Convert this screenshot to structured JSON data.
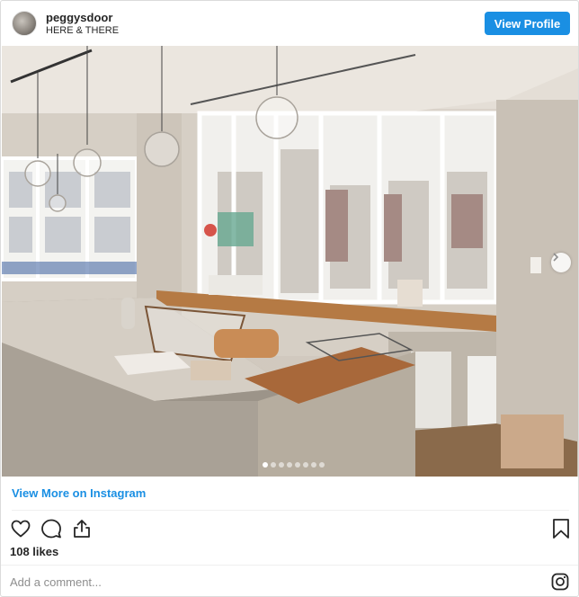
{
  "header": {
    "username": "peggysdoor",
    "location": "HERE & THERE",
    "view_profile_label": "View Profile"
  },
  "photo": {
    "description_icon": "kitchen-photo",
    "carousel_dots": 8,
    "active_dot": 1
  },
  "view_more_label": "View More on Instagram",
  "actions": {
    "icons": [
      "heart-icon",
      "comment-icon",
      "share-icon",
      "bookmark-icon"
    ]
  },
  "likes": "108 likes",
  "comment": {
    "placeholder": "Add a comment..."
  },
  "colors": {
    "accent": "#1a8fe3",
    "text": "#262626",
    "muted": "#8e8e8e"
  }
}
